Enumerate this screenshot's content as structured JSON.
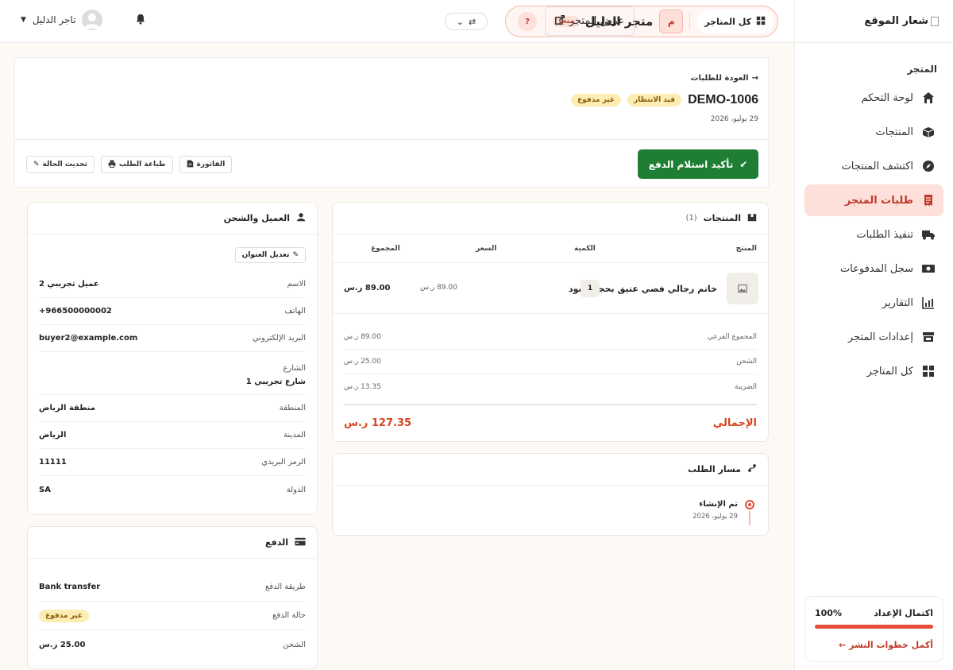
{
  "sidebar": {
    "logo_text": "شعار الموقع",
    "section_title": "المتجر",
    "items": [
      {
        "label": "لوحة التحكم",
        "icon": "home-icon"
      },
      {
        "label": "المنتجات",
        "icon": "boxes-icon"
      },
      {
        "label": "اكتشف المنتجات",
        "icon": "compass-icon"
      },
      {
        "label": "طلبات المتجر",
        "icon": "receipt-icon"
      },
      {
        "label": "تنفيذ الطلبات",
        "icon": "truck-icon"
      },
      {
        "label": "سجل المدفوعات",
        "icon": "money-icon"
      },
      {
        "label": "التقارير",
        "icon": "chart-icon"
      },
      {
        "label": "إعدادات المتجر",
        "icon": "store-icon"
      },
      {
        "label": "كل المتاجر",
        "icon": "grid-icon"
      }
    ],
    "active_index": 3,
    "setup": {
      "title": "اكتمال الإعداد",
      "percent": "100%",
      "progress": 1.0,
      "link": "أكمل خطوات النشر ←"
    }
  },
  "topbar": {
    "all_stores": "كل المتاجر",
    "store_initial": "م",
    "store_name": "متجر الدليل",
    "store_badge": "متجر",
    "help": "?",
    "view_store": "عرض المتجر",
    "user_name": "تاجر الدليل"
  },
  "order": {
    "back": "العودة للطلبات",
    "id": "DEMO-1006",
    "status_badge": "قيد الانتظار",
    "payment_badge": "غير مدفوع",
    "date": "29 يوليو، 2026",
    "confirm_button": "تأكيد استلام الدفع",
    "actions": {
      "invoice": "الفاتورة",
      "print": "طباعة الطلب",
      "update_status": "تحديث الحالة"
    }
  },
  "products": {
    "title": "المنتجات",
    "count": "(1)",
    "columns": {
      "product": "المنتج",
      "qty": "الكمية",
      "price": "السعر",
      "total": "المجموع"
    },
    "rows": [
      {
        "name": "خاتم رجالي فضي عتيق بحجر أسود",
        "qty": "1",
        "price": "89.00 ر.س",
        "total": "89.00 ر.س"
      }
    ],
    "summary": [
      {
        "label": "المجموع الفرعي",
        "value": "89.00 ر.س"
      },
      {
        "label": "الشحن",
        "value": "25.00 ر.س"
      },
      {
        "label": "الضريبة",
        "value": "13.35 ر.س"
      }
    ],
    "grand_total_label": "الإجمالي",
    "grand_total": "127.35 ر.س"
  },
  "timeline": {
    "title": "مسار الطلب",
    "events": [
      {
        "title": "تم الإنشاء",
        "date": "29 يوليو، 2026"
      }
    ]
  },
  "customer": {
    "title": "العميل والشحن",
    "edit_address": "تعديل العنوان",
    "fields": [
      {
        "label": "الاسم",
        "value": "عميل تجريبي 2"
      },
      {
        "label": "الهاتف",
        "value": "+966500000002"
      },
      {
        "label": "البريد الإلكتروني",
        "value": "buyer2@example.com"
      },
      {
        "label": "الشارع",
        "value": "شارع تجريبي 1"
      },
      {
        "label": "المنطقة",
        "value": "منطقة الرياض"
      },
      {
        "label": "المدينة",
        "value": "الرياض"
      },
      {
        "label": "الرمز البريدي",
        "value": "11111"
      },
      {
        "label": "الدولة",
        "value": "SA"
      }
    ]
  },
  "payment": {
    "title": "الدفع",
    "method_label": "طريقة الدفع",
    "method": "Bank transfer",
    "status_label": "حالة الدفع",
    "status": "غير مدفوع",
    "shipping_label": "الشحن",
    "shipping": "25.00 ر.س"
  },
  "colors": {
    "accent": "#e74c3c",
    "active_bg": "#fde0da",
    "confirm": "#1e7e34",
    "total": "#d9441f"
  }
}
